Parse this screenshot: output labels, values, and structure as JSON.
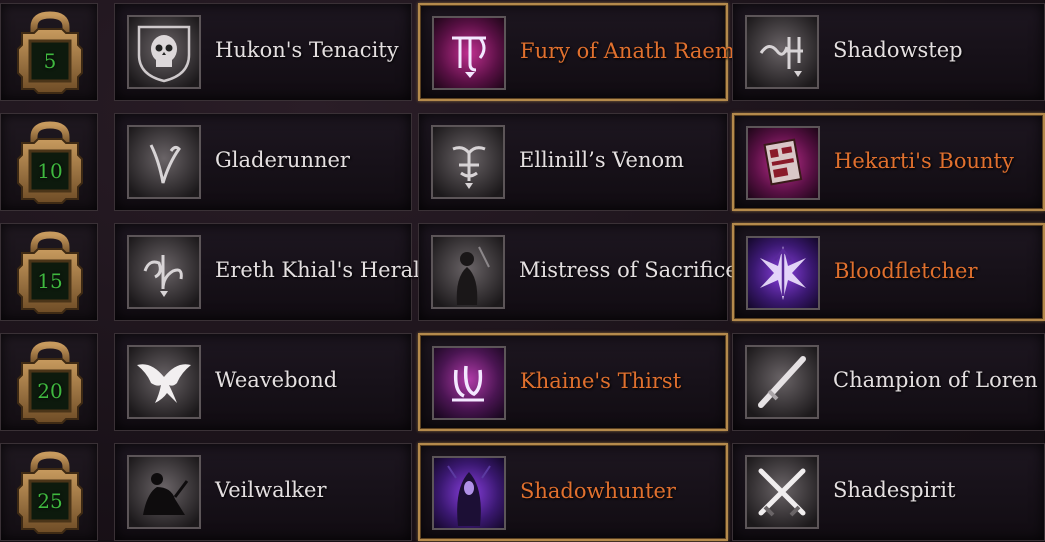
{
  "colors": {
    "selected_text": "#e0702e",
    "default_text": "#e4dfe0",
    "level_number": "#3fb83f",
    "selected_border": "#b48a4c"
  },
  "tiers": [
    {
      "level": "5",
      "talents": [
        {
          "name": "Hukon's Tenacity",
          "icon": "skull-shield-icon",
          "selected": false
        },
        {
          "name": "Fury of Anath Raema",
          "icon": "rune-anath-icon",
          "selected": true
        },
        {
          "name": "Shadowstep",
          "icon": "rune-shadow-icon",
          "selected": false
        }
      ]
    },
    {
      "level": "10",
      "talents": [
        {
          "name": "Gladerunner",
          "icon": "rune-glade-icon",
          "selected": false
        },
        {
          "name": "Ellinill’s Venom",
          "icon": "rune-venom-icon",
          "selected": false
        },
        {
          "name": "Hekarti's Bounty",
          "icon": "bounty-icon",
          "selected": true
        }
      ]
    },
    {
      "level": "15",
      "talents": [
        {
          "name": "Ereth Khial's Herald",
          "icon": "rune-herald-icon",
          "selected": false
        },
        {
          "name": "Mistress of Sacrifice",
          "icon": "figure-icon",
          "selected": false
        },
        {
          "name": "Bloodfletcher",
          "icon": "arrow-burst-icon",
          "selected": true
        }
      ]
    },
    {
      "level": "20",
      "talents": [
        {
          "name": "Weavebond",
          "icon": "bird-icon",
          "selected": false
        },
        {
          "name": "Khaine's Thirst",
          "icon": "rune-khaine-icon",
          "selected": true
        },
        {
          "name": "Champion of Loren",
          "icon": "sword-icon",
          "selected": false
        }
      ]
    },
    {
      "level": "25",
      "talents": [
        {
          "name": "Veilwalker",
          "icon": "crouching-figure-icon",
          "selected": false
        },
        {
          "name": "Shadowhunter",
          "icon": "hooded-figure-icon",
          "selected": true
        },
        {
          "name": "Shadespirit",
          "icon": "crossed-daggers-icon",
          "selected": false
        }
      ]
    }
  ]
}
